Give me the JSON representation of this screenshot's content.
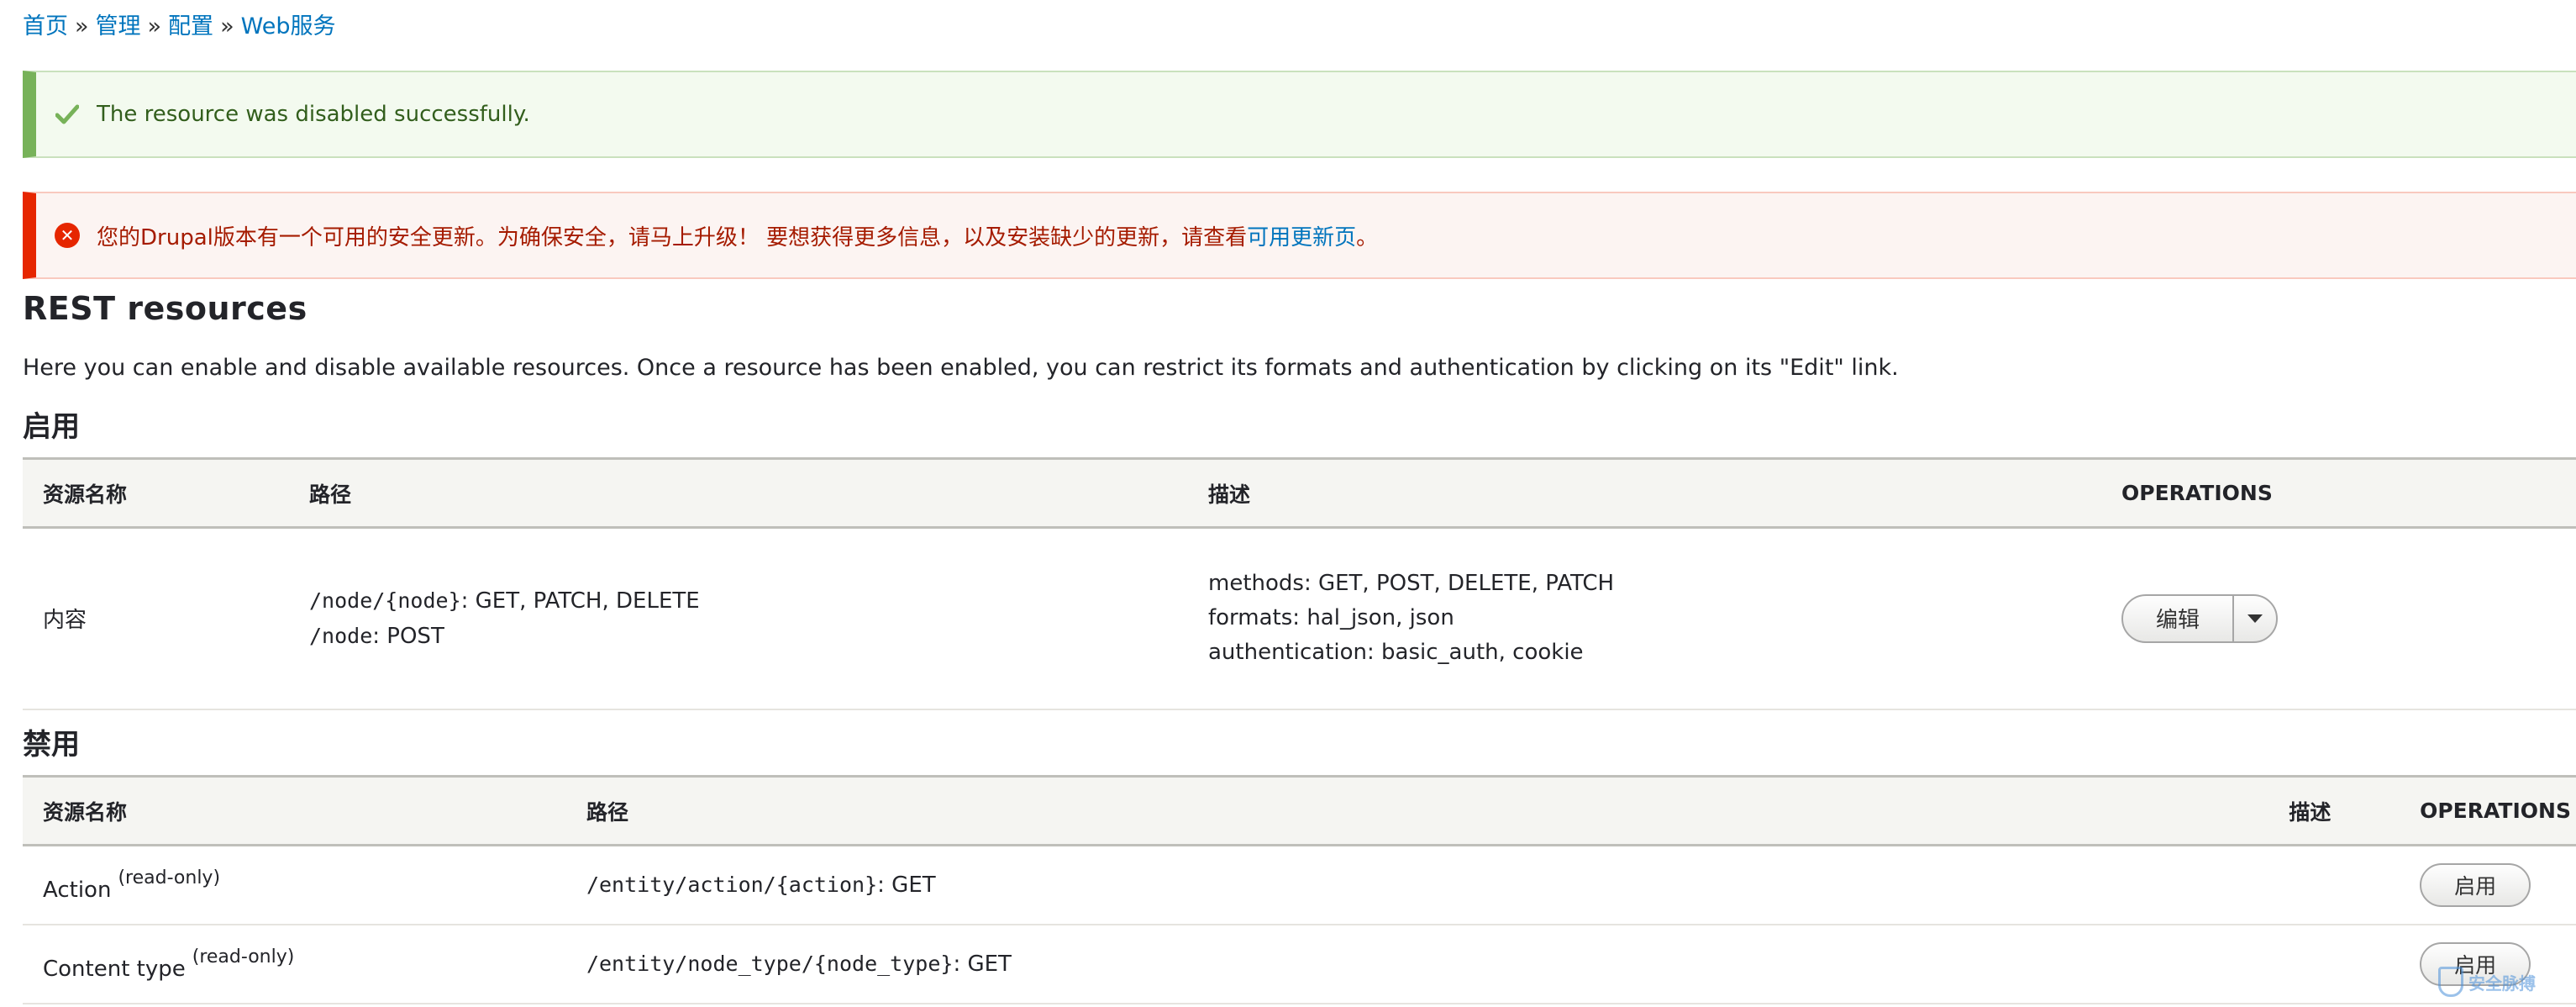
{
  "breadcrumb": {
    "items": [
      "首页",
      "管理",
      "配置",
      "Web服务"
    ],
    "separator": "»"
  },
  "status_message": {
    "text": "The resource was disabled successfully."
  },
  "error_message": {
    "text": "您的Drupal版本有一个可用的安全更新。为确保安全，请马上升级！ 要想获得更多信息，以及安装缺少的更新，请查看",
    "link_text": "可用更新页",
    "suffix": "。"
  },
  "page": {
    "title": "REST resources",
    "description": "Here you can enable and disable available resources. Once a resource has been enabled, you can restrict its formats and authentication by clicking on its \"Edit\" link."
  },
  "enabled": {
    "heading": "启用",
    "columns": [
      "资源名称",
      "路径",
      "描述",
      "OPERATIONS"
    ],
    "rows": [
      {
        "name": "内容",
        "paths": [
          {
            "path": "/node/{node}",
            "methods": ": GET, PATCH, DELETE"
          },
          {
            "path": "/node",
            "methods": ": POST"
          }
        ],
        "description": [
          "methods: GET, POST, DELETE, PATCH",
          "formats: hal_json, json",
          "authentication: basic_auth, cookie"
        ],
        "operation": "编辑"
      }
    ]
  },
  "disabled": {
    "heading": "禁用",
    "columns": [
      "资源名称",
      "路径",
      "描述",
      "OPERATIONS"
    ],
    "rows": [
      {
        "name": "Action",
        "note": "(read-only)",
        "path": "/entity/action/{action}",
        "methods": ": GET",
        "operation": "启用"
      },
      {
        "name": "Content type",
        "note": "(read-only)",
        "path": "/entity/node_type/{node_type}",
        "methods": ": GET",
        "operation": "启用"
      }
    ]
  },
  "watermark": {
    "icon": "shield-icon",
    "text": "安全脉搏"
  },
  "colors": {
    "link": "#0074bd",
    "status_accent": "#77b259",
    "error_accent": "#e62600"
  }
}
